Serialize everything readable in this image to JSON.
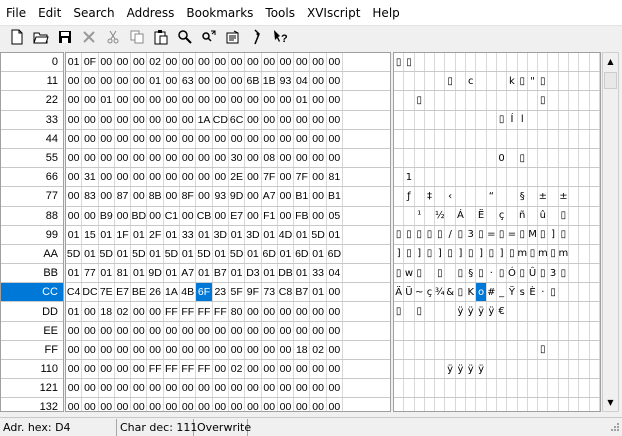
{
  "menu": [
    "File",
    "Edit",
    "Search",
    "Address",
    "Bookmarks",
    "Tools",
    "XVIscript",
    "Help"
  ],
  "toolbar": [
    {
      "name": "new-file-icon"
    },
    {
      "name": "open-folder-icon"
    },
    {
      "name": "save-icon"
    },
    {
      "name": "close-icon"
    },
    {
      "name": "cut-icon"
    },
    {
      "name": "copy-icon"
    },
    {
      "name": "paste-icon"
    },
    {
      "name": "find-icon"
    },
    {
      "name": "replace-icon"
    },
    {
      "name": "properties-icon"
    },
    {
      "name": "script-icon"
    },
    {
      "name": "context-help-icon"
    }
  ],
  "addresses": [
    "0",
    "11",
    "22",
    "33",
    "44",
    "55",
    "66",
    "77",
    "88",
    "99",
    "AA",
    "BB",
    "CC",
    "DD",
    "EE",
    "FF",
    "110",
    "121",
    "132"
  ],
  "selected_address": "CC",
  "hex_rows": [
    [
      "01",
      "0F",
      "00",
      "00",
      "00",
      "02",
      "00",
      "00",
      "00",
      "00",
      "00",
      "00",
      "00",
      "00",
      "00",
      "00",
      "00"
    ],
    [
      "00",
      "00",
      "00",
      "00",
      "00",
      "01",
      "00",
      "63",
      "00",
      "00",
      "00",
      "6B",
      "1B",
      "93",
      "04",
      "00",
      "00"
    ],
    [
      "00",
      "00",
      "01",
      "00",
      "00",
      "00",
      "00",
      "00",
      "00",
      "00",
      "00",
      "00",
      "00",
      "00",
      "01",
      "00",
      "00"
    ],
    [
      "00",
      "00",
      "00",
      "00",
      "00",
      "00",
      "00",
      "00",
      "1A",
      "CD",
      "6C",
      "00",
      "00",
      "00",
      "00",
      "00",
      "00"
    ],
    [
      "00",
      "00",
      "00",
      "00",
      "00",
      "00",
      "00",
      "00",
      "00",
      "00",
      "00",
      "00",
      "00",
      "00",
      "00",
      "00",
      "00"
    ],
    [
      "00",
      "00",
      "00",
      "00",
      "00",
      "00",
      "00",
      "00",
      "00",
      "00",
      "30",
      "00",
      "08",
      "00",
      "00",
      "00",
      "00"
    ],
    [
      "00",
      "31",
      "00",
      "00",
      "00",
      "00",
      "00",
      "00",
      "00",
      "00",
      "2E",
      "00",
      "7F",
      "00",
      "7F",
      "00",
      "81"
    ],
    [
      "00",
      "83",
      "00",
      "87",
      "00",
      "8B",
      "00",
      "8F",
      "00",
      "93",
      "9D",
      "00",
      "A7",
      "00",
      "B1",
      "00",
      "B1"
    ],
    [
      "00",
      "00",
      "B9",
      "00",
      "BD",
      "00",
      "C1",
      "00",
      "CB",
      "00",
      "E7",
      "00",
      "F1",
      "00",
      "FB",
      "00",
      "05"
    ],
    [
      "01",
      "15",
      "01",
      "1F",
      "01",
      "2F",
      "01",
      "33",
      "01",
      "3D",
      "01",
      "3D",
      "01",
      "4D",
      "01",
      "5D",
      "01"
    ],
    [
      "5D",
      "01",
      "5D",
      "01",
      "5D",
      "01",
      "5D",
      "01",
      "5D",
      "01",
      "5D",
      "01",
      "6D",
      "01",
      "6D",
      "01",
      "6D"
    ],
    [
      "01",
      "77",
      "01",
      "81",
      "01",
      "9D",
      "01",
      "A7",
      "01",
      "B7",
      "01",
      "D3",
      "01",
      "DB",
      "01",
      "33",
      "04"
    ],
    [
      "C4",
      "DC",
      "7E",
      "E7",
      "BE",
      "26",
      "1A",
      "4B",
      "6F",
      "23",
      "5F",
      "9F",
      "73",
      "C8",
      "B7",
      "01",
      "00"
    ],
    [
      "01",
      "00",
      "18",
      "02",
      "00",
      "00",
      "FF",
      "FF",
      "FF",
      "FF",
      "80",
      "00",
      "00",
      "00",
      "00",
      "00",
      "00"
    ],
    [
      "00",
      "00",
      "00",
      "00",
      "00",
      "00",
      "00",
      "00",
      "00",
      "00",
      "00",
      "00",
      "00",
      "00",
      "00",
      "00",
      "00"
    ],
    [
      "00",
      "00",
      "00",
      "00",
      "00",
      "00",
      "00",
      "00",
      "00",
      "00",
      "00",
      "00",
      "00",
      "00",
      "18",
      "02",
      "00"
    ],
    [
      "00",
      "00",
      "00",
      "00",
      "00",
      "FF",
      "FF",
      "FF",
      "FF",
      "00",
      "02",
      "00",
      "00",
      "00",
      "00",
      "00",
      "00"
    ],
    [
      "00",
      "00",
      "00",
      "00",
      "00",
      "00",
      "00",
      "00",
      "00",
      "00",
      "00",
      "00",
      "00",
      "00",
      "00",
      "00",
      "00"
    ],
    [
      "00",
      "00",
      "00",
      "00",
      "00",
      "00",
      "00",
      "00",
      "00",
      "00",
      "00",
      "00",
      "00",
      "00",
      "00",
      "00",
      "00"
    ]
  ],
  "highlight_hex": {
    "row": 12,
    "col": 8
  },
  "char_rows": [
    [
      "▯",
      "▯",
      "",
      "",
      "",
      "",
      "",
      "",
      "",
      "",
      "",
      "",
      "",
      "",
      "",
      "",
      "",
      "",
      "",
      ""
    ],
    [
      "",
      "",
      "",
      "",
      "",
      "▯",
      "",
      "c",
      "",
      "",
      "",
      "k",
      "▯",
      "\"",
      "▯",
      "",
      "",
      "",
      "",
      ""
    ],
    [
      "",
      "",
      "▯",
      "",
      "",
      "",
      "",
      "",
      "",
      "",
      "",
      "",
      "",
      "",
      "▯",
      "",
      "",
      "",
      "",
      ""
    ],
    [
      "",
      "",
      "",
      "",
      "",
      "",
      "",
      "",
      "",
      "",
      "▯",
      "Í",
      "l",
      "",
      "",
      "",
      "",
      "",
      "",
      ""
    ],
    [
      "",
      "",
      "",
      "",
      "",
      "",
      "",
      "",
      "",
      "",
      "",
      "",
      "",
      "",
      "",
      "",
      "",
      "",
      "",
      ""
    ],
    [
      "",
      "",
      "",
      "",
      "",
      "",
      "",
      "",
      "",
      "",
      "0",
      "",
      "▯",
      "",
      "",
      "",
      "",
      "",
      "",
      ""
    ],
    [
      "",
      "1",
      "",
      "",
      "",
      "",
      "",
      "",
      "",
      "",
      "",
      "",
      "",
      "",
      "",
      "",
      "",
      "",
      "",
      ""
    ],
    [
      "",
      "ƒ",
      "",
      "‡",
      "",
      "‹",
      "",
      "",
      "",
      "“",
      "",
      "",
      "§",
      "",
      "±",
      "",
      "±",
      "",
      "",
      ""
    ],
    [
      "",
      "",
      "¹",
      "",
      "½",
      "",
      "Á",
      "",
      "Ë",
      "",
      "ç",
      "",
      "ñ",
      "",
      "û",
      "",
      "▯",
      "",
      "",
      ""
    ],
    [
      "▯",
      "▯",
      "▯",
      "▯",
      "▯",
      "/",
      "▯",
      "3",
      "▯",
      "=",
      "▯",
      "=",
      "▯",
      "M",
      "▯",
      "]",
      "▯",
      "",
      "",
      ""
    ],
    [
      "]",
      "▯",
      "]",
      "▯",
      "]",
      "▯",
      "]",
      "▯",
      "]",
      "▯",
      "]",
      "▯",
      "m",
      "▯",
      "m",
      "▯",
      "m",
      "",
      "",
      ""
    ],
    [
      "▯",
      "w",
      "▯",
      "",
      "▯",
      "",
      "▯",
      "§",
      "▯",
      "·",
      "▯",
      "Ó",
      "▯",
      "Û",
      "▯",
      "3",
      "▯",
      "",
      "",
      ""
    ],
    [
      "Ä",
      "Ü",
      "~",
      "ç",
      "¾",
      "&",
      "▯",
      "K",
      "o",
      "#",
      "_",
      "Ÿ",
      "s",
      "È",
      "·",
      "▯",
      "",
      "",
      "",
      ""
    ],
    [
      "▯",
      "",
      "▯",
      "",
      "",
      "",
      "ÿ",
      "ÿ",
      "ÿ",
      "ÿ",
      "€",
      "",
      "",
      "",
      "",
      "",
      "",
      "",
      "",
      ""
    ],
    [
      "",
      "",
      "",
      "",
      "",
      "",
      "",
      "",
      "",
      "",
      "",
      "",
      "",
      "",
      "",
      "",
      "",
      "",
      "",
      ""
    ],
    [
      "",
      "",
      "",
      "",
      "",
      "",
      "",
      "",
      "",
      "",
      "",
      "",
      "",
      "",
      "▯",
      "",
      "",
      "",
      "",
      ""
    ],
    [
      "",
      "",
      "",
      "",
      "",
      "ÿ",
      "ÿ",
      "ÿ",
      "ÿ",
      "",
      "",
      "",
      "",
      "",
      "",
      "",
      "",
      "",
      "",
      ""
    ],
    [
      "",
      "",
      "",
      "",
      "",
      "",
      "",
      "",
      "",
      "",
      "",
      "",
      "",
      "",
      "",
      "",
      "",
      "",
      "",
      ""
    ],
    [
      "",
      "",
      "",
      "",
      "",
      "",
      "",
      "",
      "",
      "",
      "",
      "",
      "",
      "",
      "",
      "",
      "",
      "",
      "",
      ""
    ]
  ],
  "highlight_char": {
    "row": 12,
    "col": 8
  },
  "status": {
    "address": "Adr. hex: D4",
    "char": "Char dec: 111",
    "mode": "Overwrite"
  },
  "colors": {
    "selection": "#0078d7"
  }
}
